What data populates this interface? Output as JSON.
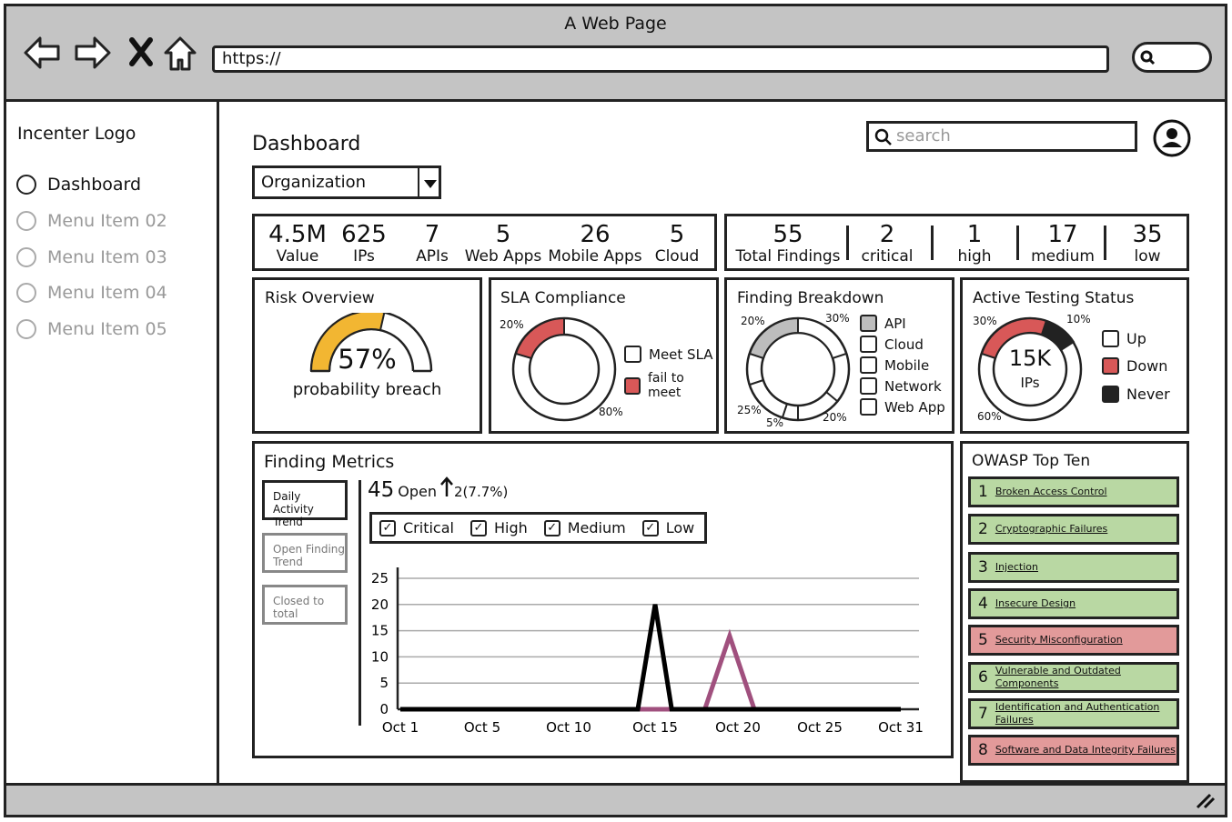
{
  "window": {
    "title": "A Web Page",
    "url": "https://"
  },
  "sidebar": {
    "logo": "Incenter Logo",
    "items": [
      {
        "label": "Dashboard"
      },
      {
        "label": "Menu Item 02"
      },
      {
        "label": "Menu Item 03"
      },
      {
        "label": "Menu Item 04"
      },
      {
        "label": "Menu Item 05"
      }
    ]
  },
  "header": {
    "title": "Dashboard",
    "org_select": "Organization",
    "search_placeholder": "search"
  },
  "assets": [
    {
      "num": "4.5M",
      "label": "Value"
    },
    {
      "num": "625",
      "label": "IPs"
    },
    {
      "num": "7",
      "label": "APIs"
    },
    {
      "num": "5",
      "label": "Web Apps"
    },
    {
      "num": "26",
      "label": "Mobile Apps"
    },
    {
      "num": "5",
      "label": "Cloud"
    }
  ],
  "findings": [
    {
      "num": "55",
      "label": "Total Findings"
    },
    {
      "num": "2",
      "label": "critical"
    },
    {
      "num": "1",
      "label": "high"
    },
    {
      "num": "17",
      "label": "medium"
    },
    {
      "num": "35",
      "label": "low"
    }
  ],
  "risk": {
    "title": "Risk Overview",
    "value": "57%",
    "caption": "probability breach",
    "fraction": 0.57
  },
  "sla": {
    "title": "SLA Compliance",
    "pct_top": "20%",
    "pct_bottom": "80%",
    "legend": [
      "Meet SLA",
      "fail to meet"
    ]
  },
  "breakdown": {
    "title": "Finding Breakdown",
    "pcts": [
      "20%",
      "30%",
      "25%",
      "5%",
      "20%"
    ],
    "legend": [
      "API",
      "Cloud",
      "Mobile",
      "Network",
      "Web App"
    ]
  },
  "testing": {
    "title": "Active Testing Status",
    "center_num": "15K",
    "center_lbl": "IPs",
    "pcts": [
      "30%",
      "10%",
      "60%"
    ],
    "legend": [
      "Up",
      "Down",
      "Never"
    ]
  },
  "metrics": {
    "title": "Finding Metrics",
    "tabs": [
      "Daily Activity Trend",
      "Open Finding Trend",
      "Closed to total"
    ],
    "open_num": "45",
    "open_lbl": "Open",
    "open_delta": "2(7.7%)",
    "filters": [
      "Critical",
      "High",
      "Medium",
      "Low"
    ]
  },
  "chart_data": {
    "type": "line",
    "x": [
      "Oct 1",
      "Oct 5",
      "Oct 10",
      "Oct 15",
      "Oct 20",
      "Oct 25",
      "Oct 31"
    ],
    "yticks": [
      0,
      5,
      10,
      15,
      20,
      25
    ],
    "ylim": [
      0,
      25
    ],
    "series": [
      {
        "values_x": [
          1,
          14,
          15,
          16,
          31
        ],
        "values_y": [
          0,
          0,
          20,
          0,
          0
        ],
        "color": "#000000"
      },
      {
        "values_x": [
          1,
          18,
          19.5,
          21,
          31
        ],
        "values_y": [
          0,
          0,
          14,
          0,
          0
        ],
        "color": "#a0507e"
      }
    ]
  },
  "owasp": {
    "title": "OWASP Top Ten",
    "items": [
      {
        "n": "1",
        "label": "Broken Access Control",
        "status": "good"
      },
      {
        "n": "2",
        "label": "Cryptographic Failures",
        "status": "good"
      },
      {
        "n": "3",
        "label": "Injection",
        "status": "good"
      },
      {
        "n": "4",
        "label": "Insecure Design",
        "status": "good"
      },
      {
        "n": "5",
        "label": "Security Misconfiguration",
        "status": "bad"
      },
      {
        "n": "6",
        "label": "Vulnerable and Outdated Components",
        "status": "good"
      },
      {
        "n": "7",
        "label": "Identification and Authentication Failures",
        "status": "good"
      },
      {
        "n": "8",
        "label": "Software and Data Integrity Failures",
        "status": "bad"
      }
    ]
  },
  "colors": {
    "good": "#b9d8a3",
    "bad": "#e29a9a",
    "gauge": "#f2b632",
    "red": "#d85858",
    "gray": "#bdbdbd"
  }
}
